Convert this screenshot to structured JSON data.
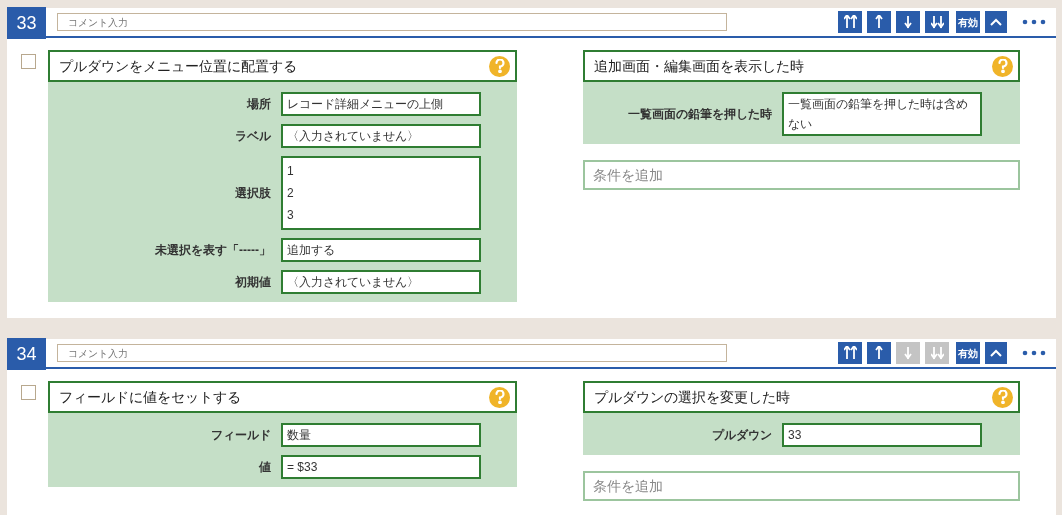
{
  "rules": [
    {
      "number": "33",
      "comment_placeholder": "コメント入力",
      "toolbar": [
        {
          "kind": "top",
          "disabled": false
        },
        {
          "kind": "up",
          "disabled": false
        },
        {
          "kind": "down",
          "disabled": false
        },
        {
          "kind": "bottom",
          "disabled": false
        }
      ],
      "toggle_label": "有効",
      "checked": false,
      "action": {
        "title": "プルダウンをメニュー位置に配置する",
        "fields": [
          {
            "label": "場所",
            "kind": "text",
            "value": "レコード詳細メニューの上側"
          },
          {
            "label": "ラベル",
            "kind": "text",
            "value": "〈入力されていません〉"
          },
          {
            "label": "選択肢",
            "kind": "list",
            "lines": [
              "1",
              "2",
              "3"
            ]
          },
          {
            "label": "未選択を表す「-----」",
            "kind": "text",
            "value": "追加する"
          },
          {
            "label": "初期値",
            "kind": "text",
            "value": "〈入力されていません〉"
          }
        ]
      },
      "trigger": {
        "title": "追加画面・編集画面を表示した時",
        "fields": [
          {
            "label": "一覧画面の鉛筆を押した時",
            "kind": "text",
            "value": "一覧画面の鉛筆を押した時は含めない"
          }
        ]
      },
      "condition_placeholder": "条件を追加"
    },
    {
      "number": "34",
      "comment_placeholder": "コメント入力",
      "toolbar": [
        {
          "kind": "top",
          "disabled": false
        },
        {
          "kind": "up",
          "disabled": false
        },
        {
          "kind": "down",
          "disabled": true
        },
        {
          "kind": "bottom",
          "disabled": true
        }
      ],
      "toggle_label": "有効",
      "checked": false,
      "action": {
        "title": "フィールドに値をセットする",
        "fields": [
          {
            "label": "フィールド",
            "kind": "text",
            "value": "数量"
          },
          {
            "label": "値",
            "kind": "text",
            "value": "= $33"
          }
        ]
      },
      "trigger": {
        "title": "プルダウンの選択を変更した時",
        "fields": [
          {
            "label": "プルダウン",
            "kind": "text",
            "value": "33"
          }
        ]
      },
      "condition_placeholder": "条件を追加"
    }
  ]
}
